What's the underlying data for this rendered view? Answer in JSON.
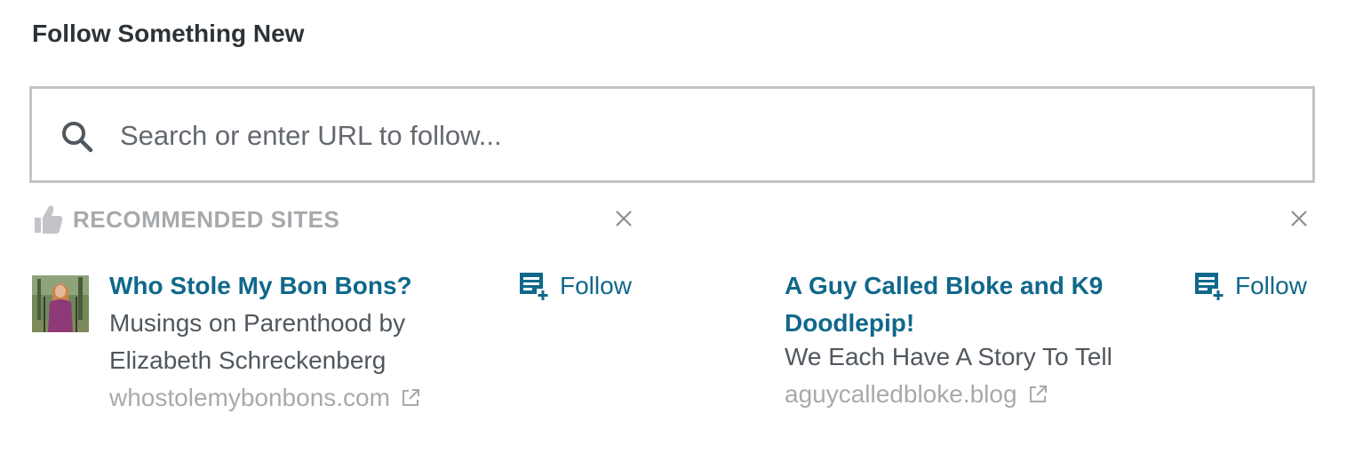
{
  "heading": "Follow Something New",
  "search": {
    "placeholder": "Search or enter URL to follow..."
  },
  "recommended": {
    "title": "RECOMMENDED SITES",
    "sites": [
      {
        "title": "Who Stole My Bon Bons?",
        "description_line1": "Musings on Parenthood by",
        "description_line2": "Elizabeth Schreckenberg",
        "url": "whostolemybonbons.com",
        "follow_label": "Follow"
      },
      {
        "title_line1": "A Guy Called Bloke and K9",
        "title_line2": "Doodlepip!",
        "description": "We Each Have A Story To Tell",
        "url": "aguycalledbloke.blog",
        "follow_label": "Follow"
      }
    ]
  },
  "colors": {
    "link": "#10688b",
    "muted": "#a7aaad",
    "text": "#50575e",
    "border": "#c3c4c7"
  }
}
